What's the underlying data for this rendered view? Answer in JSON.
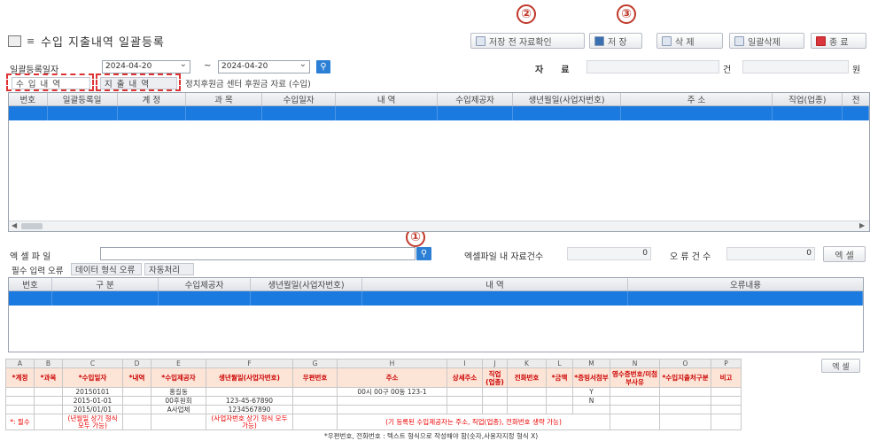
{
  "title": "수입 지출내역 일괄등록",
  "toolbar": {
    "btn_check": "저장 전 자료확인",
    "btn_save": "저 장",
    "btn_delete": "삭 제",
    "btn_bulk_delete": "일괄삭제",
    "btn_close": "종 료"
  },
  "markers": {
    "m1": "①",
    "m2": "②",
    "m3": "③"
  },
  "filter": {
    "date_label": "일괄등록일자",
    "date_from": "2024-04-20",
    "tilde": "~",
    "date_to": "2024-04-20",
    "data_label": "자　　료",
    "count_label": "건",
    "won_label": "원"
  },
  "tabs": {
    "income": "수 입 내 역",
    "expense": "지 출 내 역",
    "center": "정치후원금 센터 후원금 자료 (수입)"
  },
  "grid1": {
    "headers": [
      "번호",
      "일괄등록일",
      "계 정",
      "과 목",
      "수입일자",
      "내 역",
      "수입제공자",
      "생년월일(사업자번호)",
      "주 소",
      "직업(업종)",
      "전"
    ]
  },
  "excel": {
    "file_label": "엑 셀 파 일",
    "records_label": "엑셀파일 내 자료건수",
    "records_value": "0",
    "errors_label": "오 류 건 수",
    "errors_value": "0",
    "excel_button": "엑 셀"
  },
  "err_tabs": {
    "required": "필수 입력 오류",
    "format": "데이터 형식 오류",
    "auto": "자동처리"
  },
  "grid2": {
    "headers": [
      "번호",
      "구 분",
      "수입제공자",
      "생년월일(사업자번호)",
      "내 역",
      "오류내용"
    ]
  },
  "excel_preview": {
    "letters": [
      "A",
      "B",
      "C",
      "D",
      "E",
      "F",
      "G",
      "H",
      "I",
      "J",
      "K",
      "L",
      "M",
      "N",
      "O",
      "P"
    ],
    "headers": [
      "*계정",
      "*과목",
      "*수입일자",
      "*내역",
      "*수입제공자",
      "생년월일(사업자번호)",
      "우편번호",
      "주소",
      "상세주소",
      "직업\n(업종)",
      "전화번호",
      "*금액",
      "*증빙서첨부",
      "영수증번호/미첨부사유",
      "*수입지출처구분",
      "비고"
    ],
    "rows": [
      [
        "",
        "",
        "20150101",
        "",
        "홍길동",
        "",
        "",
        "00시 00구 00동 123-1",
        "",
        "",
        "",
        "",
        "Y",
        "",
        "",
        ""
      ],
      [
        "",
        "",
        "2015-01-01",
        "",
        "00후원회",
        "123-45-67890",
        "",
        "",
        "",
        "",
        "",
        "",
        "N",
        "",
        "",
        ""
      ],
      [
        "",
        "",
        "2015/01/01",
        "",
        "A사업체",
        "1234567890",
        "",
        "",
        "",
        "",
        "",
        "",
        "",
        "",
        "",
        ""
      ],
      [
        "*: 필수",
        "",
        "(년월일 상기 형식 모두 가능)",
        "",
        "",
        "(사업자번호 상기 형식 모두 가능)",
        "",
        "(기 등록된 수입제공자는 주소, 직업(업종), 전화번호 생략 가능)",
        "",
        "",
        "",
        "",
        "",
        "",
        "",
        ""
      ]
    ],
    "footnote": "*우편번호, 전화번호 : 텍스트 형식으로 작성해야 함(숫자,사용자지정 형식 X)",
    "side_button": "엑 셀"
  }
}
